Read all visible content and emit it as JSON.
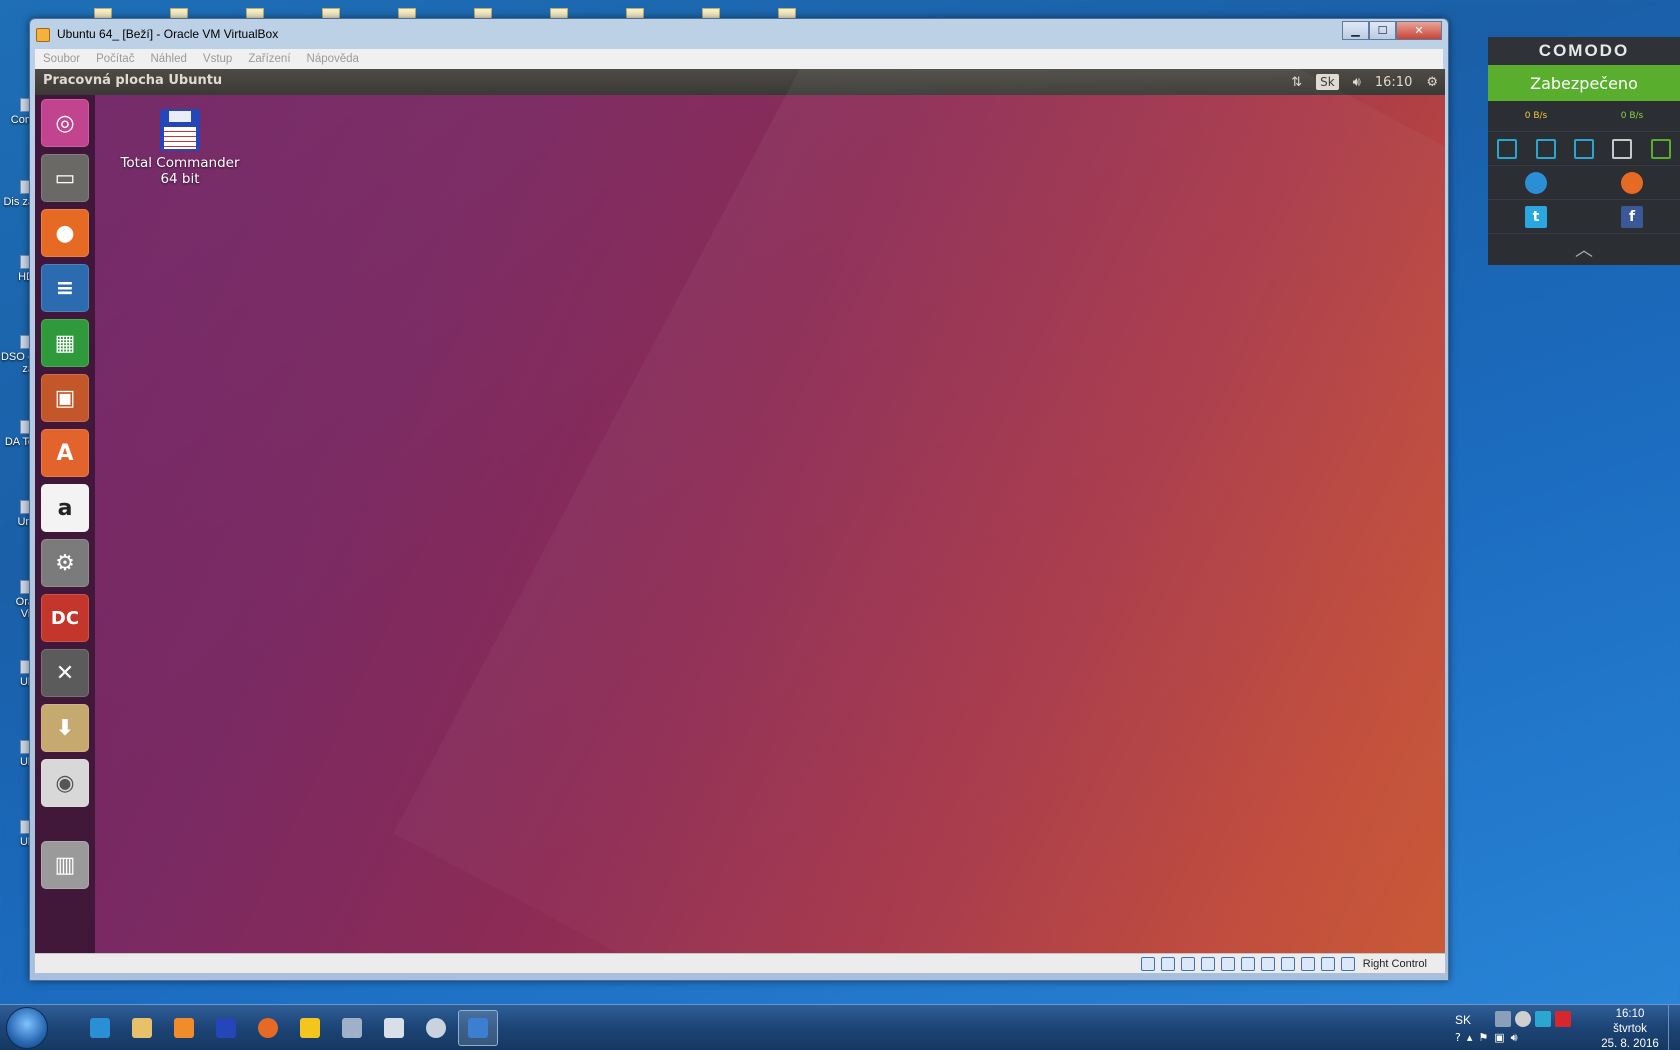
{
  "vbox": {
    "title": "Ubuntu 64_ [Beží] - Oracle VM VirtualBox",
    "menu": [
      "Soubor",
      "Počítač",
      "Náhled",
      "Vstup",
      "Zařízení",
      "Nápověda"
    ],
    "host_key": "Right Control",
    "buttons": {
      "minimize": "▁",
      "maximize": "☐",
      "close": "✕"
    }
  },
  "ubuntu": {
    "panel_title": "Pracovná plocha Ubuntu",
    "keyboard_layout": "Sk",
    "time": "16:10",
    "desktop_icon_label_line1": "Total Commander",
    "desktop_icon_label_line2": "64 bit",
    "launcher_items": [
      {
        "name": "ubuntu-dash",
        "glyph": "◎",
        "color": "#c3448e"
      },
      {
        "name": "files",
        "glyph": "▭",
        "color": "#6b6965"
      },
      {
        "name": "firefox",
        "glyph": "●",
        "color": "#e76a24"
      },
      {
        "name": "libreoffice-writer",
        "glyph": "≡",
        "color": "#2d6bb1"
      },
      {
        "name": "libreoffice-calc",
        "glyph": "▦",
        "color": "#2f9a3b"
      },
      {
        "name": "libreoffice-impress",
        "glyph": "▣",
        "color": "#c4572a"
      },
      {
        "name": "ubuntu-software",
        "glyph": "A",
        "color": "#e2632b"
      },
      {
        "name": "amazon",
        "glyph": "a",
        "color": "#f3f3f3"
      },
      {
        "name": "system-settings",
        "glyph": "⚙",
        "color": "#7b7b7b"
      },
      {
        "name": "double-commander",
        "glyph": "DC",
        "color": "#c4362b"
      },
      {
        "name": "wine-tools",
        "glyph": "✕",
        "color": "#5b5b5b"
      },
      {
        "name": "archive-manager",
        "glyph": "⬇",
        "color": "#c5a96f"
      },
      {
        "name": "disc",
        "glyph": "◉",
        "color": "#d8d8d8"
      },
      {
        "name": "trash",
        "glyph": "🗑",
        "color": "#9a9a9a"
      }
    ]
  },
  "comodo": {
    "logo": "COMODO",
    "status": "Zabezpečeno",
    "upload_speed": "0 B/s",
    "download_speed": "0 B/s"
  },
  "taskbar": {
    "language": "SK",
    "clock_time": "16:10",
    "clock_day": "štvrtok",
    "clock_date": "25. 8. 2016"
  },
  "desktop_left_labels": [
    "Com",
    "Dis\nzá",
    "HD",
    "DSO\n– za",
    "DA\nTo",
    "Uni",
    "Ora\nVir",
    "Ub",
    "Ub",
    "Ub"
  ]
}
